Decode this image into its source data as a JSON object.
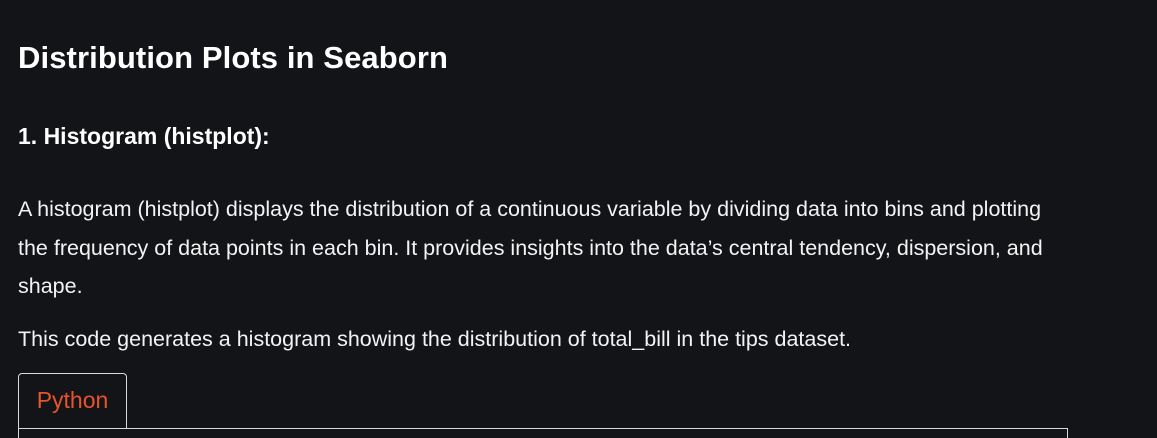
{
  "article": {
    "title": "Distribution Plots in Seaborn",
    "section_heading": "1. Histogram (histplot):",
    "paragraphs": [
      "A histogram (histplot) displays the distribution of a continuous variable by dividing data into bins and plotting the frequency of data points in each bin. It provides insights into the data’s central tendency, dispersion, and shape.",
      "This code generates a histogram showing the distribution of total_bill in the tips dataset."
    ]
  },
  "code_block": {
    "tabs": [
      {
        "label": "Python",
        "active": true
      }
    ]
  },
  "colors": {
    "background": "#131417",
    "text": "#ffffff",
    "tab_accent": "#e8532b",
    "border": "#d9d9d9"
  }
}
